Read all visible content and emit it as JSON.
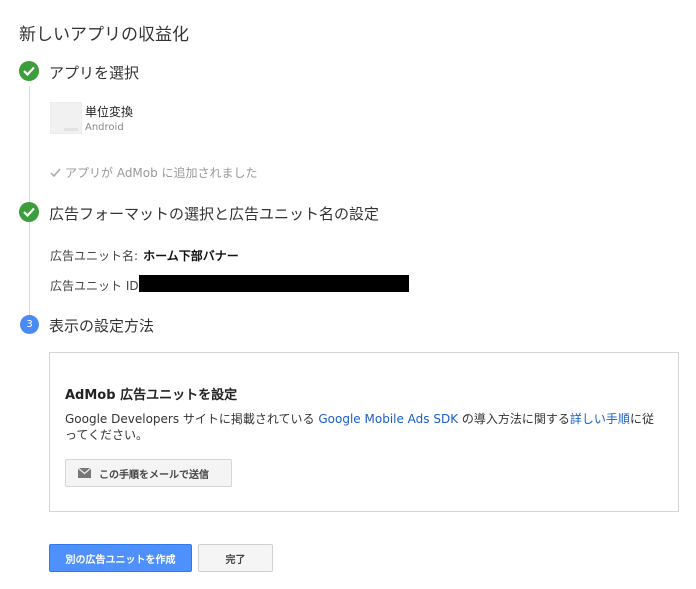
{
  "page": {
    "title": "新しいアプリの収益化"
  },
  "steps": [
    {
      "title": "アプリを選択",
      "status": "done"
    },
    {
      "title": "広告フォーマットの選択と広告ユニット名の設定",
      "status": "done"
    },
    {
      "number": "3",
      "title": "表示の設定方法",
      "status": "current"
    }
  ],
  "app": {
    "name": "単位変換",
    "platform": "Android"
  },
  "added_message": "アプリが AdMob に追加されました",
  "ad_unit": {
    "name_label": "広告ユニット名:",
    "name_value": "ホーム下部バナー",
    "id_label": "広告ユニット ID:"
  },
  "setup": {
    "title": "AdMob 広告ユニットを設定",
    "desc_part1": "Google Developers サイトに掲載されている ",
    "desc_link1": "Google Mobile Ads SDK",
    "desc_part2": " の導入方法に関する",
    "desc_link2": "詳しい手順",
    "desc_part3": "に従ってください。",
    "email_button": "この手順をメールで送信"
  },
  "buttons": {
    "create_another": "別の広告ユニットを作成",
    "done": "完了"
  },
  "colors": {
    "check_green": "#3b9e3b",
    "accent_blue": "#4d90fe",
    "link_blue": "#1a5fc7"
  }
}
